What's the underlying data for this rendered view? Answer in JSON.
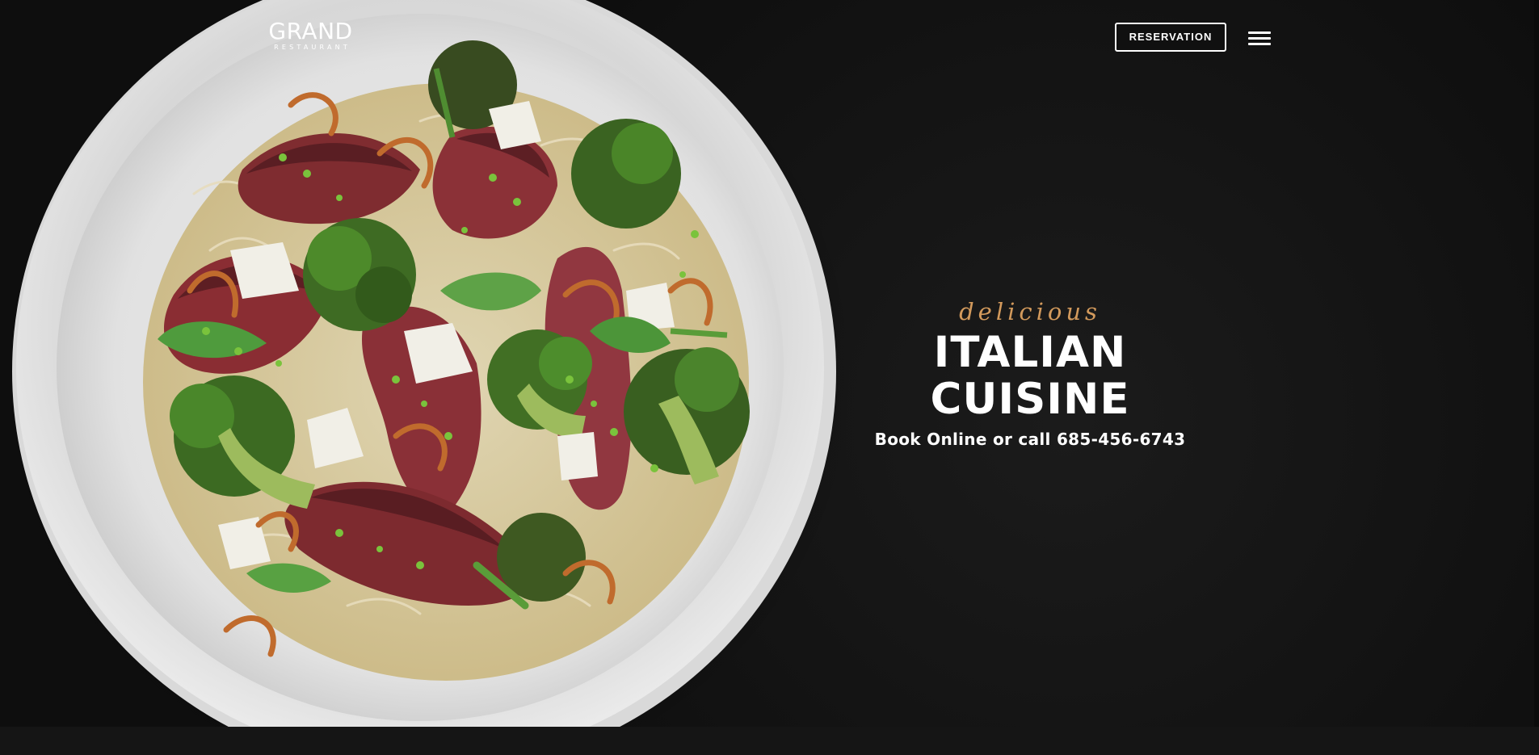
{
  "header": {
    "logo": {
      "main": "GRAND",
      "sub": "RESTAURANT"
    },
    "reservation_label": "RESERVATION",
    "menu_icon": "hamburger-menu-icon"
  },
  "hero": {
    "tagline": "delicious",
    "headline": "ITALIAN CUISINE",
    "subline": "Book Online or call 685-456-6743"
  },
  "colors": {
    "background": "#141414",
    "accent": "#d39a5c",
    "text": "#ffffff"
  }
}
